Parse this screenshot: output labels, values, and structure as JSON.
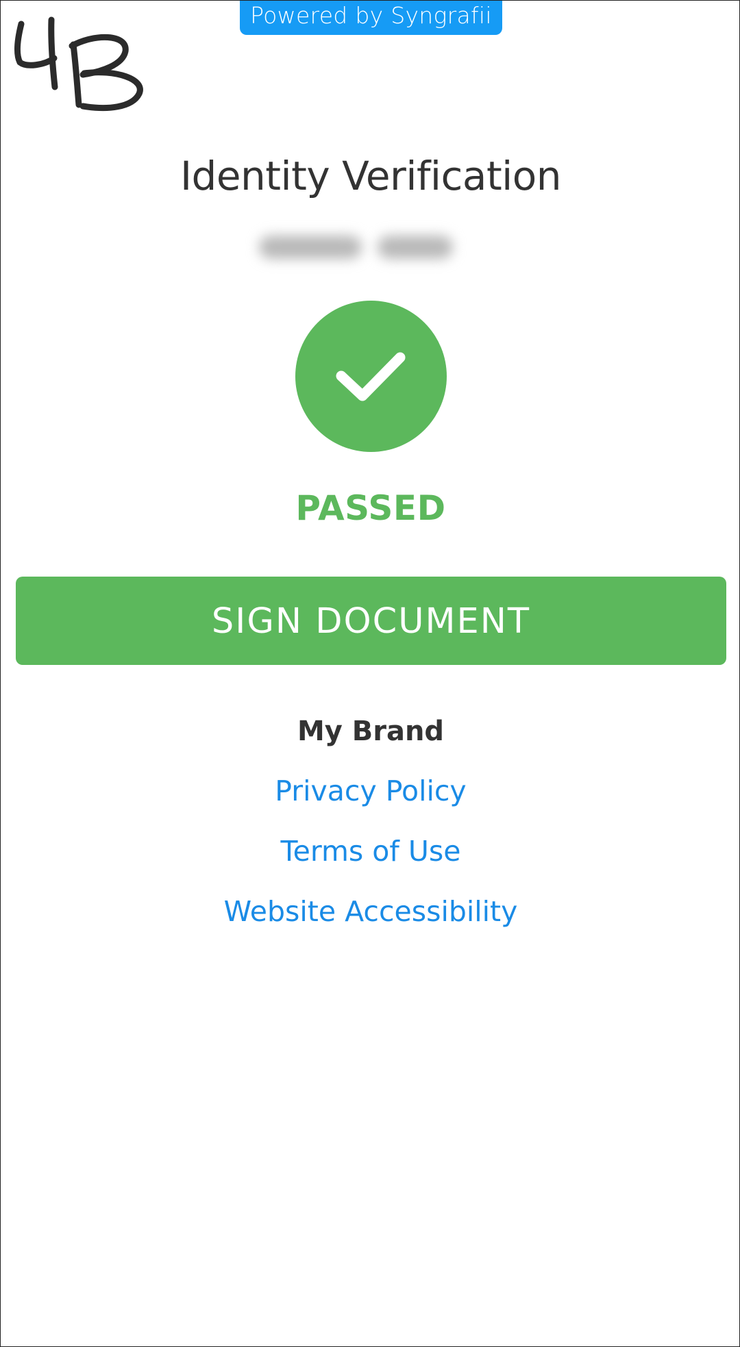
{
  "banner": {
    "text": "Powered by Syngrafii",
    "color": "#0a96f5"
  },
  "handwritten_mark": {
    "text": "4B"
  },
  "header": {
    "title": "Identity Verification"
  },
  "verification": {
    "icon": "check-icon",
    "status": "PASSED",
    "status_color": "#5cb85c"
  },
  "actions": {
    "sign_label": "SIGN DOCUMENT",
    "button_color": "#5cb85c"
  },
  "footer": {
    "brand": "My Brand",
    "link_color": "#1a8be6",
    "links": [
      {
        "label": "Privacy Policy"
      },
      {
        "label": "Terms of Use"
      },
      {
        "label": "Website Accessibility"
      }
    ]
  }
}
